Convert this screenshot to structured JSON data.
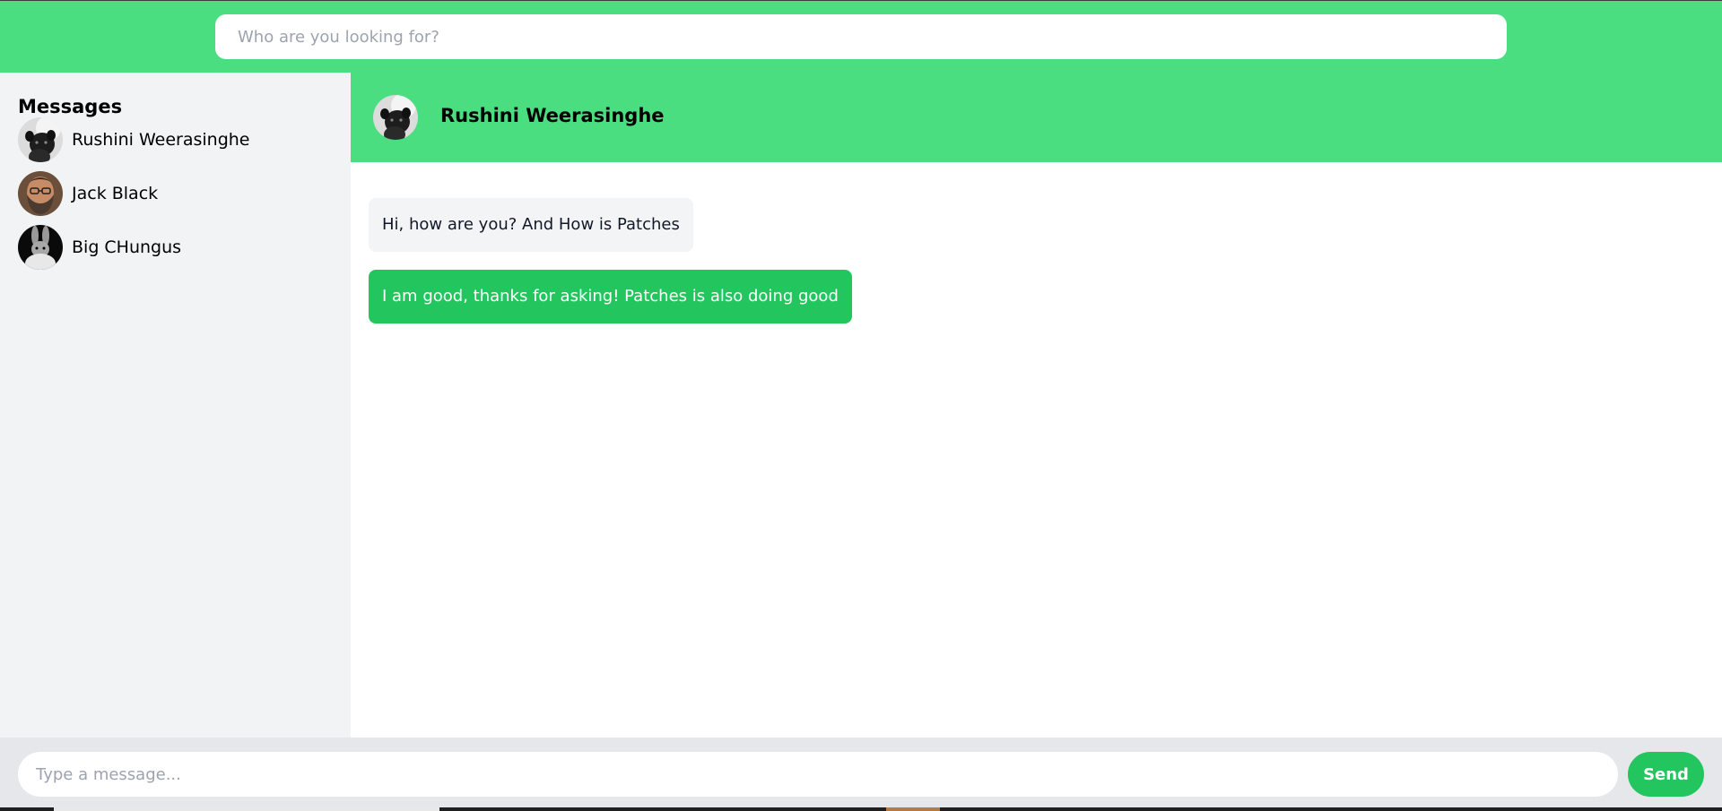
{
  "search": {
    "placeholder": "Who are you looking for?"
  },
  "sidebar": {
    "title": "Messages",
    "contacts": [
      {
        "name": "Rushini Weerasinghe",
        "avatar": "pug-avatar"
      },
      {
        "name": "Jack Black",
        "avatar": "bearded-man-avatar"
      },
      {
        "name": "Big CHungus",
        "avatar": "rabbit-avatar"
      }
    ]
  },
  "chat": {
    "contact_name": "Rushini Weerasinghe",
    "messages": [
      {
        "direction": "received",
        "text": "Hi, how are you? And How is Patches"
      },
      {
        "direction": "sent",
        "text": "I am good, thanks for asking! Patches is also doing good"
      }
    ]
  },
  "composer": {
    "placeholder": "Type a message...",
    "send_label": "Send"
  },
  "colors": {
    "header_green": "#4ade80",
    "accent_green": "#22c55e",
    "sidebar_bg": "#f1f3f5",
    "received_bubble": "#f3f4f6",
    "composer_bg": "#e5e7eb"
  }
}
